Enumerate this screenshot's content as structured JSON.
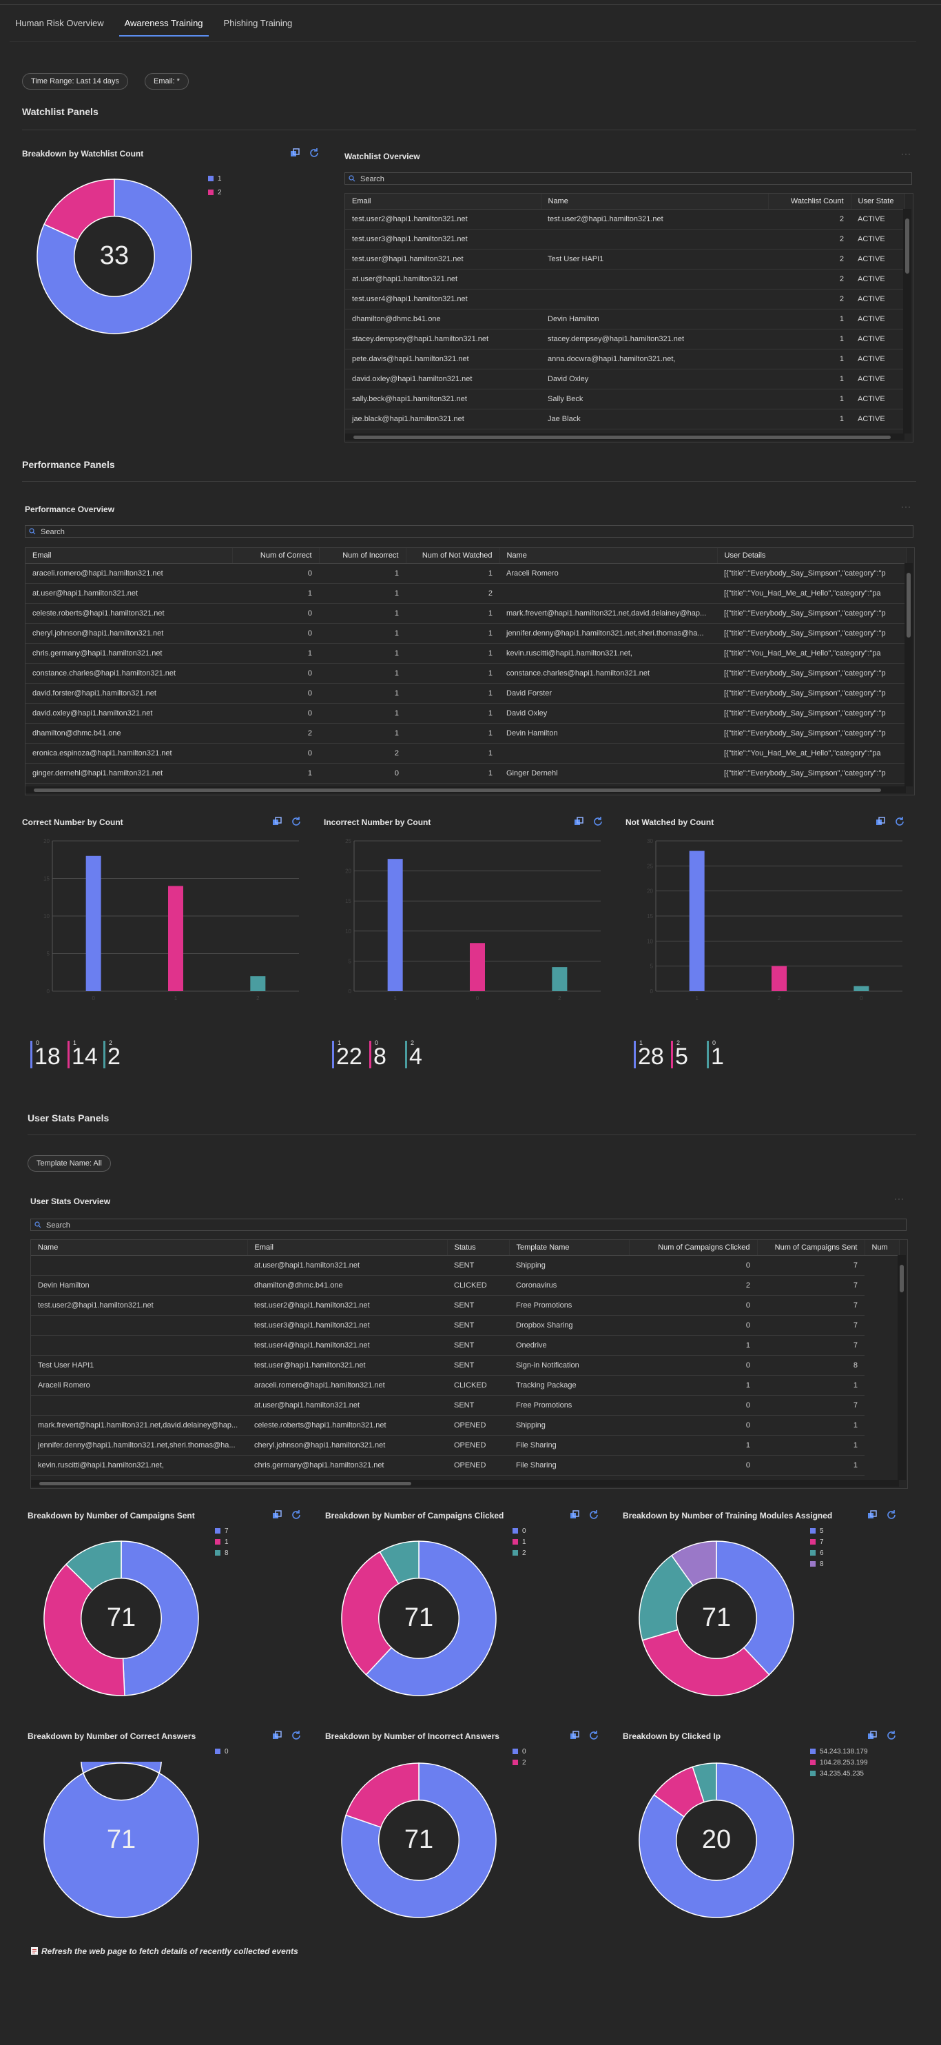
{
  "tabs": [
    "Human Risk Overview",
    "Awareness Training",
    "Phishing Training"
  ],
  "filters": {
    "time_range": "Time Range: Last 14 days",
    "email": "Email: *",
    "template": "Template Name: All"
  },
  "sections": {
    "watchlist": "Watchlist Panels",
    "performance": "Performance Panels",
    "userstats": "User Stats Panels"
  },
  "colors": {
    "blue": "#6b7ff0",
    "pink": "#e0338c",
    "teal": "#4a9da0",
    "purple": "#9a78c8",
    "accent": "#5b8def"
  },
  "icons": {
    "export": "pin-to-dashboard-icon",
    "refresh": "refresh-icon",
    "search": "search-icon",
    "more": "more-icon"
  },
  "watch_count": {
    "title": "Breakdown by Watchlist Count",
    "center": "33",
    "legend": [
      "1",
      "2"
    ],
    "values": [
      27,
      6
    ]
  },
  "watch_overview": {
    "title": "Watchlist Overview",
    "search": "Search",
    "columns": [
      "Email",
      "Name",
      "Watchlist Count",
      "User State"
    ],
    "rows": [
      [
        "test.user2@hapi1.hamilton321.net",
        "test.user2@hapi1.hamilton321.net",
        "2",
        "ACTIVE"
      ],
      [
        "test.user3@hapi1.hamilton321.net",
        "",
        "2",
        "ACTIVE"
      ],
      [
        "test.user@hapi1.hamilton321.net",
        "Test User HAPI1",
        "2",
        "ACTIVE"
      ],
      [
        "at.user@hapi1.hamilton321.net",
        "",
        "2",
        "ACTIVE"
      ],
      [
        "test.user4@hapi1.hamilton321.net",
        "",
        "2",
        "ACTIVE"
      ],
      [
        "dhamilton@dhmc.b41.one",
        "Devin Hamilton",
        "1",
        "ACTIVE"
      ],
      [
        "stacey.dempsey@hapi1.hamilton321.net",
        "stacey.dempsey@hapi1.hamilton321.net",
        "1",
        "ACTIVE"
      ],
      [
        "pete.davis@hapi1.hamilton321.net",
        "anna.docwra@hapi1.hamilton321.net,",
        "1",
        "ACTIVE"
      ],
      [
        "david.oxley@hapi1.hamilton321.net",
        "David Oxley",
        "1",
        "ACTIVE"
      ],
      [
        "sally.beck@hapi1.hamilton321.net",
        "Sally Beck",
        "1",
        "ACTIVE"
      ],
      [
        "jae.black@hapi1.hamilton321.net",
        "Jae Black",
        "1",
        "ACTIVE"
      ]
    ]
  },
  "perf_overview": {
    "title": "Performance Overview",
    "search": "Search",
    "columns": [
      "Email",
      "Num of Correct",
      "Num of Incorrect",
      "Num of Not Watched",
      "Name",
      "User Details"
    ],
    "rows": [
      [
        "araceli.romero@hapi1.hamilton321.net",
        "0",
        "1",
        "1",
        "Araceli Romero",
        "[{\"title\":\"Everybody_Say_Simpson\",\"category\":\"p"
      ],
      [
        "at.user@hapi1.hamilton321.net",
        "1",
        "1",
        "2",
        "",
        "[{\"title\":\"You_Had_Me_at_Hello\",\"category\":\"pa"
      ],
      [
        "celeste.roberts@hapi1.hamilton321.net",
        "0",
        "1",
        "1",
        "mark.frevert@hapi1.hamilton321.net,david.delainey@hap...",
        "[{\"title\":\"Everybody_Say_Simpson\",\"category\":\"p"
      ],
      [
        "cheryl.johnson@hapi1.hamilton321.net",
        "0",
        "1",
        "1",
        "jennifer.denny@hapi1.hamilton321.net,sheri.thomas@ha...",
        "[{\"title\":\"Everybody_Say_Simpson\",\"category\":\"p"
      ],
      [
        "chris.germany@hapi1.hamilton321.net",
        "1",
        "1",
        "1",
        "kevin.ruscitti@hapi1.hamilton321.net,",
        "[{\"title\":\"You_Had_Me_at_Hello\",\"category\":\"pa"
      ],
      [
        "constance.charles@hapi1.hamilton321.net",
        "0",
        "1",
        "1",
        "constance.charles@hapi1.hamilton321.net",
        "[{\"title\":\"Everybody_Say_Simpson\",\"category\":\"p"
      ],
      [
        "david.forster@hapi1.hamilton321.net",
        "0",
        "1",
        "1",
        "David Forster",
        "[{\"title\":\"Everybody_Say_Simpson\",\"category\":\"p"
      ],
      [
        "david.oxley@hapi1.hamilton321.net",
        "0",
        "1",
        "1",
        "David Oxley",
        "[{\"title\":\"Everybody_Say_Simpson\",\"category\":\"p"
      ],
      [
        "dhamilton@dhmc.b41.one",
        "2",
        "1",
        "1",
        "Devin Hamilton",
        "[{\"title\":\"Everybody_Say_Simpson\",\"category\":\"p"
      ],
      [
        "eronica.espinoza@hapi1.hamilton321.net",
        "0",
        "2",
        "1",
        "",
        "[{\"title\":\"You_Had_Me_at_Hello\",\"category\":\"pa"
      ],
      [
        "ginger.dernehl@hapi1.hamilton321.net",
        "1",
        "0",
        "1",
        "Ginger Dernehl",
        "[{\"title\":\"Everybody_Say_Simpson\",\"category\":\"p"
      ]
    ]
  },
  "bar_charts": [
    {
      "title": "Correct Number by Count",
      "categories": [
        "0",
        "1",
        "2"
      ],
      "values": [
        18,
        14,
        2
      ],
      "ymax": 20,
      "ticks": [
        0,
        5,
        10,
        15,
        20
      ]
    },
    {
      "title": "Incorrect Number by Count",
      "categories": [
        "1",
        "0",
        "2"
      ],
      "values": [
        22,
        8,
        4
      ],
      "ymax": 25,
      "ticks": [
        0,
        5,
        10,
        15,
        20,
        25
      ]
    },
    {
      "title": "Not Watched by Count",
      "categories": [
        "1",
        "2",
        "0"
      ],
      "values": [
        28,
        5,
        1
      ],
      "ymax": 30,
      "ticks": [
        0,
        5,
        10,
        15,
        20,
        25,
        30
      ]
    }
  ],
  "kpis": [
    [
      {
        "label": "0",
        "value": "18"
      },
      {
        "label": "1",
        "value": "14"
      },
      {
        "label": "2",
        "value": "2"
      }
    ],
    [
      {
        "label": "1",
        "value": "22"
      },
      {
        "label": "0",
        "value": "8"
      },
      {
        "label": "2",
        "value": "4"
      }
    ],
    [
      {
        "label": "1",
        "value": "28"
      },
      {
        "label": "2",
        "value": "5"
      },
      {
        "label": "0",
        "value": "1"
      }
    ]
  ],
  "user_overview": {
    "title": "User Stats Overview",
    "search": "Search",
    "columns": [
      "Name",
      "Email",
      "Status",
      "Template Name",
      "Num of Campaigns Clicked",
      "Num of Campaigns Sent",
      "Num"
    ],
    "rows": [
      [
        "",
        "at.user@hapi1.hamilton321.net",
        "SENT",
        "Shipping",
        "0",
        "7"
      ],
      [
        "Devin Hamilton",
        "dhamilton@dhmc.b41.one",
        "CLICKED",
        "Coronavirus",
        "2",
        "7"
      ],
      [
        "test.user2@hapi1.hamilton321.net",
        "test.user2@hapi1.hamilton321.net",
        "SENT",
        "Free Promotions",
        "0",
        "7"
      ],
      [
        "",
        "test.user3@hapi1.hamilton321.net",
        "SENT",
        "Dropbox Sharing",
        "0",
        "7"
      ],
      [
        "",
        "test.user4@hapi1.hamilton321.net",
        "SENT",
        "Onedrive",
        "1",
        "7"
      ],
      [
        "Test User HAPI1",
        "test.user@hapi1.hamilton321.net",
        "SENT",
        "Sign-in Notification",
        "0",
        "8"
      ],
      [
        "Araceli Romero",
        "araceli.romero@hapi1.hamilton321.net",
        "CLICKED",
        "Tracking Package",
        "1",
        "1"
      ],
      [
        "",
        "at.user@hapi1.hamilton321.net",
        "SENT",
        "Free Promotions",
        "0",
        "7"
      ],
      [
        "mark.frevert@hapi1.hamilton321.net,david.delainey@hap...",
        "celeste.roberts@hapi1.hamilton321.net",
        "OPENED",
        "Shipping",
        "0",
        "1"
      ],
      [
        "jennifer.denny@hapi1.hamilton321.net,sheri.thomas@ha...",
        "cheryl.johnson@hapi1.hamilton321.net",
        "OPENED",
        "File Sharing",
        "1",
        "1"
      ],
      [
        "kevin.ruscitti@hapi1.hamilton321.net,",
        "chris.germany@hapi1.hamilton321.net",
        "OPENED",
        "File Sharing",
        "0",
        "1"
      ]
    ]
  },
  "donuts_row1": [
    {
      "title": "Breakdown by Number of Campaigns Sent",
      "center": "71",
      "legend": [
        "7",
        "1",
        "8"
      ],
      "values": [
        35,
        27,
        9
      ]
    },
    {
      "title": "Breakdown by Number of Campaigns Clicked",
      "center": "71",
      "legend": [
        "0",
        "1",
        "2"
      ],
      "values": [
        44,
        21,
        6
      ]
    },
    {
      "title": "Breakdown by Number of Training Modules Assigned",
      "center": "71",
      "legend": [
        "5",
        "7",
        "6",
        "8"
      ],
      "values": [
        27,
        23,
        14,
        7
      ]
    }
  ],
  "donuts_row2": [
    {
      "title": "Breakdown by Number of Correct Answers",
      "center": "71",
      "legend": [
        "0"
      ],
      "values": [
        71
      ]
    },
    {
      "title": "Breakdown by Number of Incorrect Answers",
      "center": "71",
      "legend": [
        "0",
        "2"
      ],
      "values": [
        57,
        14
      ]
    },
    {
      "title": "Breakdown by Clicked Ip",
      "center": "20",
      "legend": [
        "54.243.138.179",
        "104.28.253.199",
        "34.235.45.235"
      ],
      "values": [
        17,
        2,
        1
      ]
    }
  ],
  "footnote": "Refresh the web page to fetch details of recently collected events"
}
